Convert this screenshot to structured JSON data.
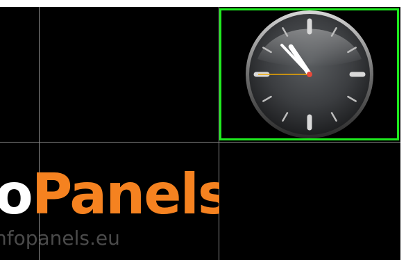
{
  "logo": {
    "part_a": "fo",
    "part_b": "Panels",
    "url": "nfopanels.eu"
  },
  "clock": {
    "hour": 10,
    "minute": 52,
    "second": 45
  },
  "colors": {
    "logo_orange": "#f58220",
    "selection_border": "#1eea1e",
    "background": "#000000",
    "grid_line": "#8a8a8a"
  }
}
